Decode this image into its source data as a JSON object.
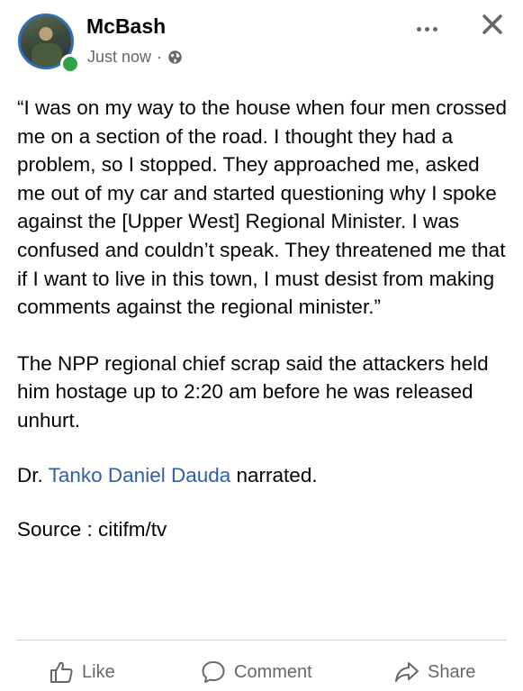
{
  "post": {
    "author": "McBash",
    "timestamp": "Just now",
    "separator": "·",
    "audience_icon": "globe-icon",
    "online": true,
    "quote_text": "“I was on my way to the house when four men crossed me on a section of the road. I thought they had a problem, so I stopped. They approached me, asked me out of my car and started questioning why I spoke against the [Upper West] Regional Minister. I was confused and couldn’t speak. They threatened me that if I want to live in this town, I must desist from making comments against the regional minister.”",
    "paragraph2": "The NPP regional chief scrap said the attackers held him hostage up to 2:20 am before he was released unhurt.",
    "paragraph3_prefix": "Dr.",
    "paragraph3_mention": "Tanko Daniel Dauda",
    "paragraph3_suffix": "narrated.",
    "source": "Source : citifm/tv"
  },
  "actions": {
    "like_label": "Like",
    "comment_label": "Comment",
    "share_label": "Share"
  },
  "colors": {
    "mention": "#2f5fa8",
    "online_dot": "#31a24c",
    "secondary_text": "#65676b"
  }
}
